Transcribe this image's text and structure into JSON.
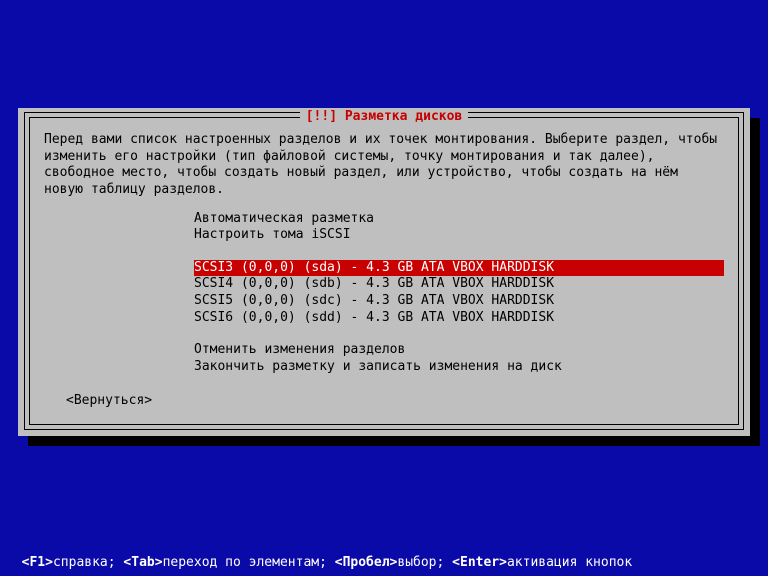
{
  "title": "[!!] Разметка дисков",
  "intro": "Перед вами список настроенных разделов и их точек монтирования. Выберите раздел, чтобы изменить его настройки (тип файловой системы, точку монтирования и так далее), свободное место, чтобы создать новый раздел, или устройство, чтобы создать на нём новую таблицу разделов.",
  "menu_top": [
    "Автоматическая разметка",
    "Настроить тома iSCSI"
  ],
  "disks": [
    "SCSI3 (0,0,0) (sda) - 4.3 GB ATA VBOX HARDDISK",
    "SCSI4 (0,0,0) (sdb) - 4.3 GB ATA VBOX HARDDISK",
    "SCSI5 (0,0,0) (sdc) - 4.3 GB ATA VBOX HARDDISK",
    "SCSI6 (0,0,0) (sdd) - 4.3 GB ATA VBOX HARDDISK"
  ],
  "selected_disk": 0,
  "menu_bottom": [
    "Отменить изменения разделов",
    "Закончить разметку и записать изменения на диск"
  ],
  "back": "<Вернуться>",
  "help": {
    "f1_key": "<F1>",
    "f1_txt": "справка; ",
    "tab_key": "<Tab>",
    "tab_txt": "переход по элементам; ",
    "space_key": "<Пробел>",
    "space_txt": "выбор; ",
    "enter_key": "<Enter>",
    "enter_txt": "активация кнопок"
  }
}
